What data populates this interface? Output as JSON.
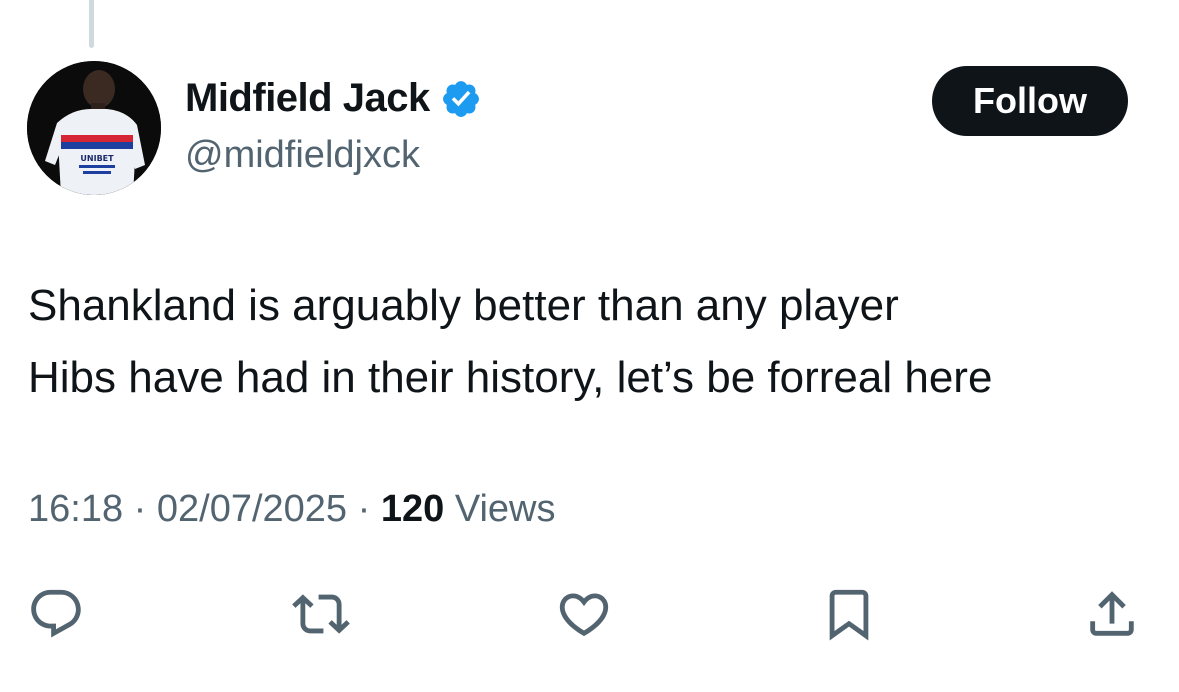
{
  "author": {
    "display_name": "Midfield Jack",
    "handle": "@midfieldjxck",
    "avatar_shirt_text": "UNIBET",
    "verified_icon": "verified-badge-icon"
  },
  "follow_button": {
    "label": "Follow"
  },
  "tweet": {
    "lines": [
      "Shankland is arguably better than any player",
      "Hibs have had in their history, let’s be forreal here"
    ]
  },
  "meta": {
    "time": "16:18",
    "separator": "·",
    "date": "02/07/2025",
    "views_count": "120",
    "views_label": "Views"
  },
  "actions": [
    {
      "icon": "reply-icon"
    },
    {
      "icon": "retweet-icon"
    },
    {
      "icon": "like-icon"
    },
    {
      "icon": "bookmark-icon"
    },
    {
      "icon": "share-icon"
    }
  ],
  "colors": {
    "text_primary": "#0f1419",
    "text_secondary": "#536471",
    "verified_blue": "#1d9bf0",
    "button_bg": "#0f1419",
    "thread_line": "#cfd9de"
  }
}
